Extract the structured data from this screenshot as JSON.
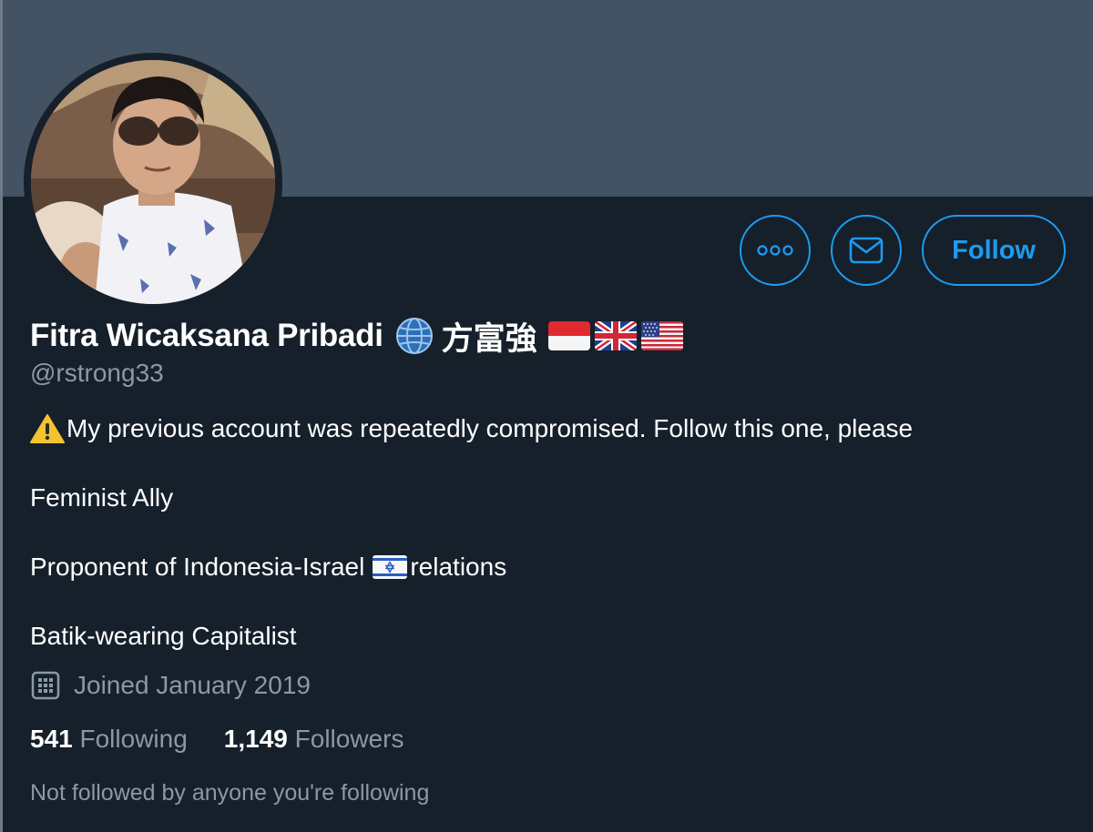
{
  "profile": {
    "display_name": "Fitra Wicaksana Pribadi",
    "name_cjk": "方富強",
    "handle": "@rstrong33",
    "flags": [
      "flag-indonesia",
      "flag-united-kingdom",
      "flag-united-states"
    ]
  },
  "actions": {
    "more_icon": "more-dots-icon",
    "message_icon": "mail-icon",
    "follow_label": "Follow"
  },
  "bio": {
    "line1": "My previous account was repeatedly compromised. Follow this one, please",
    "line2": "Feminist Ally",
    "line3_before": "Proponent of Indonesia-Israel",
    "line3_after": "relations",
    "line4": "Batik-wearing Capitalist"
  },
  "meta": {
    "joined": "Joined January 2019"
  },
  "stats": {
    "following_count": "541",
    "following_label": "Following",
    "followers_count": "1,149",
    "followers_label": "Followers"
  },
  "note": "Not followed by anyone you're following",
  "colors": {
    "background": "#15202b",
    "banner": "#435364",
    "accent": "#1d9bf0",
    "secondary_text": "#8b98a5"
  }
}
